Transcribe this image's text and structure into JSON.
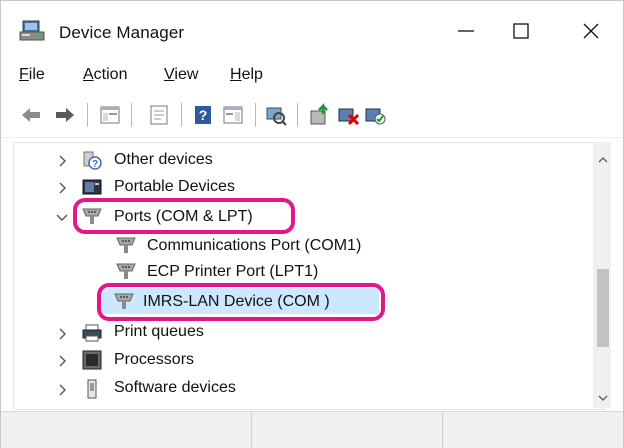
{
  "window": {
    "title": "Device Manager"
  },
  "menu": [
    {
      "label": "File",
      "accel": "F",
      "rest": "ile"
    },
    {
      "label": "Action",
      "accel": "A",
      "rest": "ction"
    },
    {
      "label": "View",
      "accel": "V",
      "rest": "iew"
    },
    {
      "label": "Help",
      "accel": "H",
      "rest": "elp"
    }
  ],
  "toolbar": {
    "icons": [
      "back-arrow-icon",
      "forward-arrow-icon",
      "show-hide-console-tree-icon",
      "properties-icon",
      "help-icon",
      "action-pane-icon",
      "scan-hardware-icon",
      "update-driver-icon",
      "uninstall-device-icon",
      "enable-device-icon"
    ]
  },
  "tree": {
    "items": [
      {
        "label": "Other devices",
        "icon": "other-devices-icon",
        "state": "collapsed"
      },
      {
        "label": "Portable Devices",
        "icon": "portable-devices-icon",
        "state": "collapsed"
      },
      {
        "label": "Ports (COM & LPT)",
        "icon": "port-icon",
        "state": "expanded"
      },
      {
        "label": "Communications Port (COM1)",
        "icon": "port-icon",
        "state": "leaf"
      },
      {
        "label": "ECP Printer Port (LPT1)",
        "icon": "port-icon",
        "state": "leaf"
      },
      {
        "label": "IMRS-LAN Device (COM )",
        "icon": "port-icon",
        "state": "leaf-selected"
      },
      {
        "label": "Print queues",
        "icon": "printer-icon",
        "state": "collapsed"
      },
      {
        "label": "Processors",
        "icon": "processor-icon",
        "state": "collapsed"
      },
      {
        "label": "Software devices",
        "icon": "software-device-icon",
        "state": "collapsed"
      }
    ]
  },
  "colors": {
    "highlight": "#e3178a",
    "selection": "#cce8ff"
  }
}
